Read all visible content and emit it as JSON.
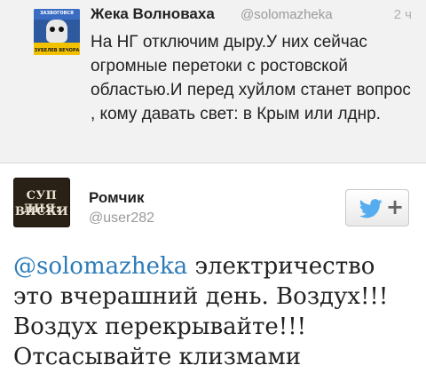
{
  "top_tweet": {
    "author_name": "Жека Волноваха",
    "handle": "@solomazheka",
    "time": "2 ч",
    "text": "На НГ отключим дыру.У них сейчас огромные перетоки с ростовской областью.И перед хуйлом станет вопрос , кому давать свет: в Крым или лднр.",
    "avatar_caption_top": "ЗАЗВОГОВСЯ",
    "avatar_caption_bottom": "ЗУБЕЛЕВ ВЕЧОРА"
  },
  "main_tweet": {
    "author_name": "Ромчик",
    "handle": "@user282",
    "avatar_line1": "СУП ДНЯ:",
    "avatar_line2": "ВИСКИ",
    "mention": "@solomazheka",
    "text": " электричество это вчерашний день. Воздух!!! Воздух перекрывайте!!! Отсасывайте клизмами",
    "follow_button_symbol": "+"
  },
  "colors": {
    "link": "#2b7bb9",
    "bird": "#55acee",
    "top_background": "#f2f2f2"
  },
  "icons": [
    "twitter-bird-icon",
    "plus-icon"
  ]
}
